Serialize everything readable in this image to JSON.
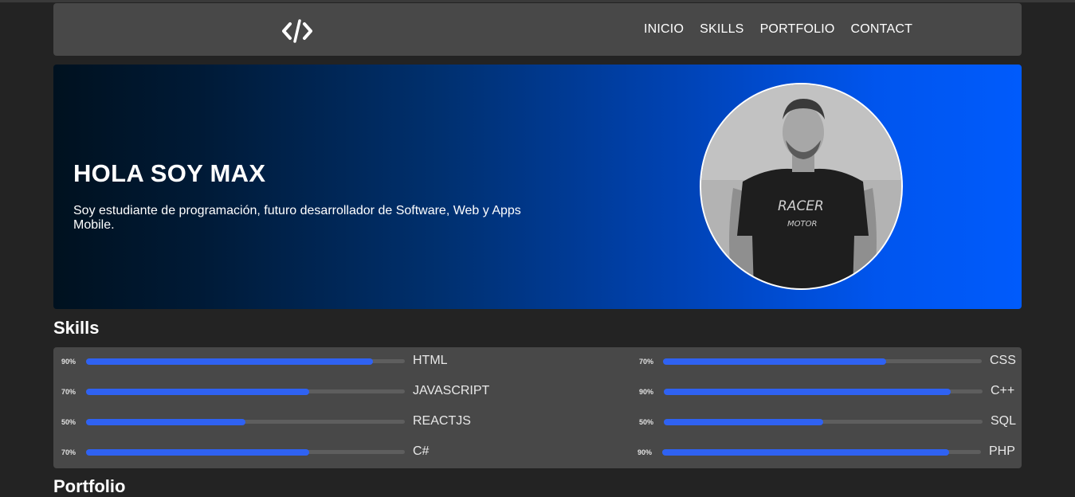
{
  "header": {
    "logo_icon": "code-brackets-icon",
    "nav": [
      {
        "label": "INICIO"
      },
      {
        "label": "SKILLS"
      },
      {
        "label": "PORTFOLIO"
      },
      {
        "label": "CONTACT"
      }
    ]
  },
  "hero": {
    "title": "HOLA SOY MAX",
    "text": "Soy estudiante de programación, futuro desarrollador de Software, Web y Apps Mobile.",
    "avatar": "profile-photo"
  },
  "skills": {
    "title": "Skills",
    "bar_color": "#2f62f2",
    "left": [
      {
        "percent": "90%",
        "level": 0.9,
        "name": "HTML"
      },
      {
        "percent": "70%",
        "level": 0.7,
        "name": "JAVASCRIPT"
      },
      {
        "percent": "50%",
        "level": 0.5,
        "name": "REACTJS"
      },
      {
        "percent": "70%",
        "level": 0.7,
        "name": "C#"
      }
    ],
    "right": [
      {
        "percent": "70%",
        "level": 0.7,
        "name": "CSS"
      },
      {
        "percent": "90%",
        "level": 0.9,
        "name": "C++"
      },
      {
        "percent": "50%",
        "level": 0.5,
        "name": "SQL"
      },
      {
        "percent": "90%",
        "level": 0.9,
        "name": "PHP"
      }
    ]
  },
  "portfolio": {
    "title": "Portfolio"
  }
}
